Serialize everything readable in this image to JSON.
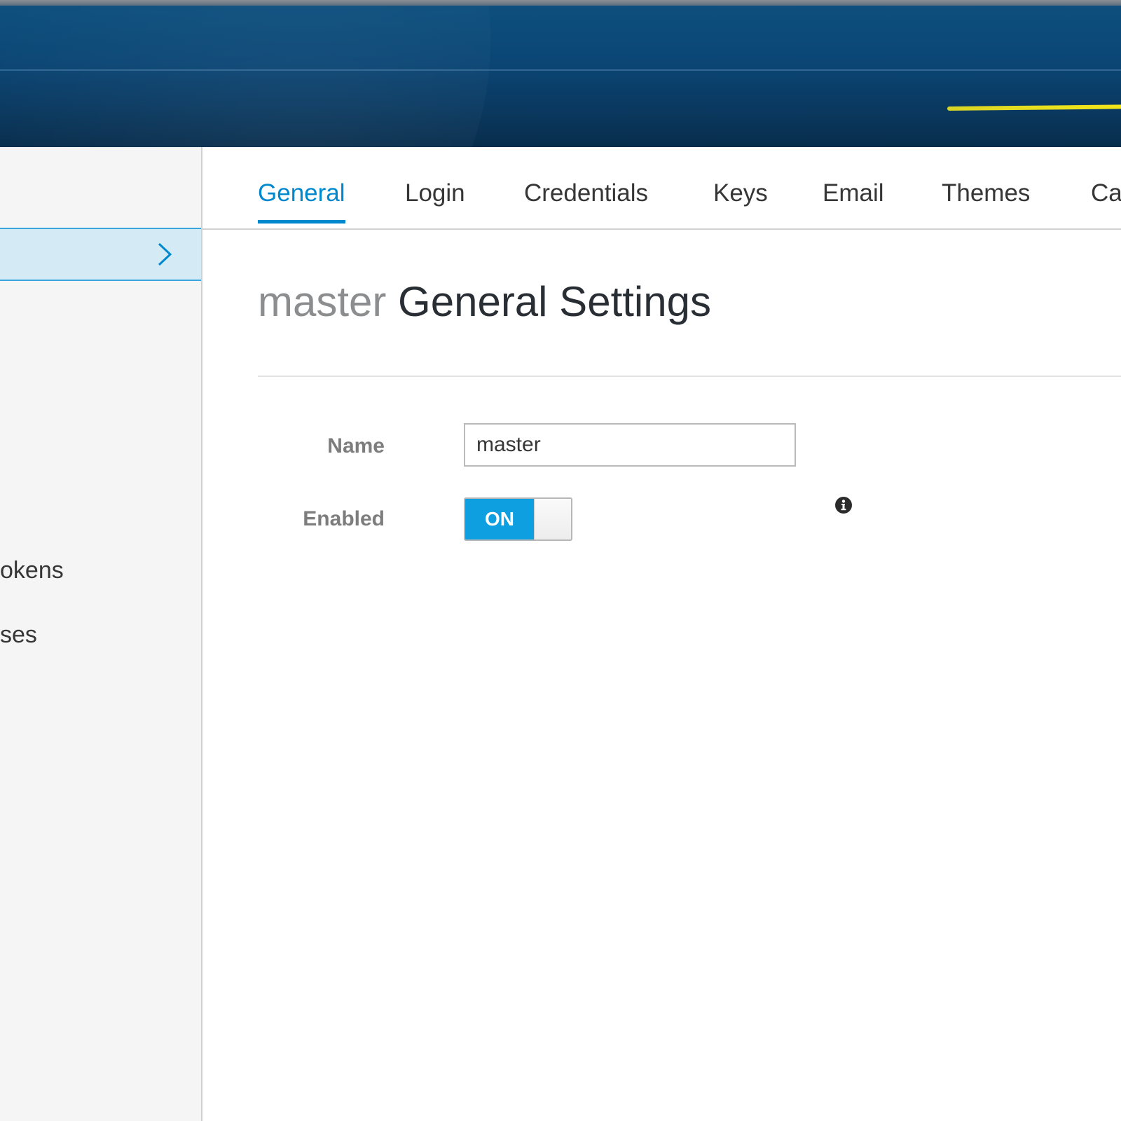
{
  "sidebar": {
    "items": [
      {
        "label": "okens"
      },
      {
        "label": "ses"
      }
    ]
  },
  "tabs": [
    {
      "label": "General",
      "active": true
    },
    {
      "label": "Login",
      "active": false
    },
    {
      "label": "Credentials",
      "active": false
    },
    {
      "label": "Keys",
      "active": false
    },
    {
      "label": "Email",
      "active": false
    },
    {
      "label": "Themes",
      "active": false
    },
    {
      "label": "Ca",
      "active": false
    }
  ],
  "page": {
    "realm_name": "master",
    "title": "General Settings"
  },
  "form": {
    "name_label": "Name",
    "name_value": "master",
    "enabled_label": "Enabled",
    "enabled_toggle_label": "ON",
    "enabled": true
  },
  "icons": {
    "sidebar_chevron": "chevron-right-icon",
    "enabled_help": "info-icon"
  },
  "colors": {
    "accent": "#0088ce",
    "toggle_on": "#0d9fe0",
    "header": "#0b4675",
    "sidebar_active": "#d4ebf6",
    "header_streak": "#f4e718"
  }
}
